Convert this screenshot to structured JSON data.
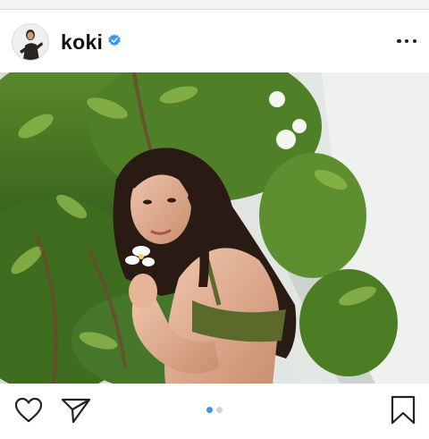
{
  "post": {
    "username": "koki",
    "verified": true,
    "photo_alt": "koki",
    "carousel": {
      "count": 2,
      "active_index": 0
    }
  },
  "icons": {
    "verified": "verified-badge-icon",
    "more": "more-options-icon",
    "like": "heart-icon",
    "share": "paper-plane-icon",
    "save": "bookmark-icon"
  },
  "colors": {
    "verified_blue": "#3897f0",
    "active_dot": "#3897f0",
    "inactive_dot": "#d3d3d3"
  }
}
